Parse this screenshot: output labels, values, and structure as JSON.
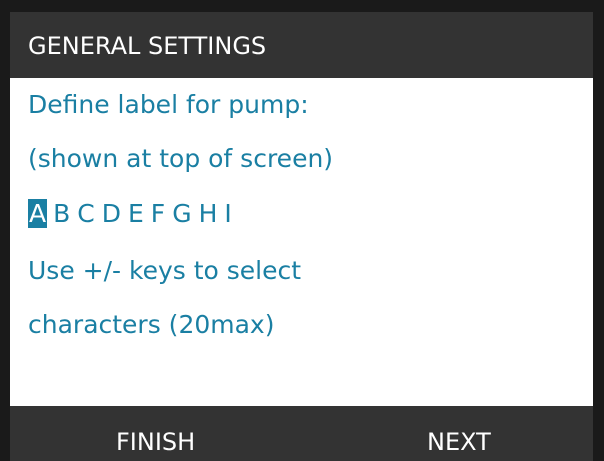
{
  "header": {
    "title": "GENERAL SETTINGS"
  },
  "prompt": {
    "line1": "Define label for pump:",
    "line2": "(shown at top of screen)"
  },
  "label_editor": {
    "characters": [
      "A",
      "B",
      "C",
      "D",
      "E",
      "F",
      "G",
      "H",
      "I"
    ],
    "selected_index": 0
  },
  "help": {
    "line1": "Use +/- keys to select",
    "line2": "characters (20max)"
  },
  "softkeys": {
    "left": "FINISH",
    "right": "NEXT"
  },
  "colors": {
    "accent_text": "#1a7fa3",
    "bar_background": "#333333",
    "screen_background": "#ffffff"
  }
}
